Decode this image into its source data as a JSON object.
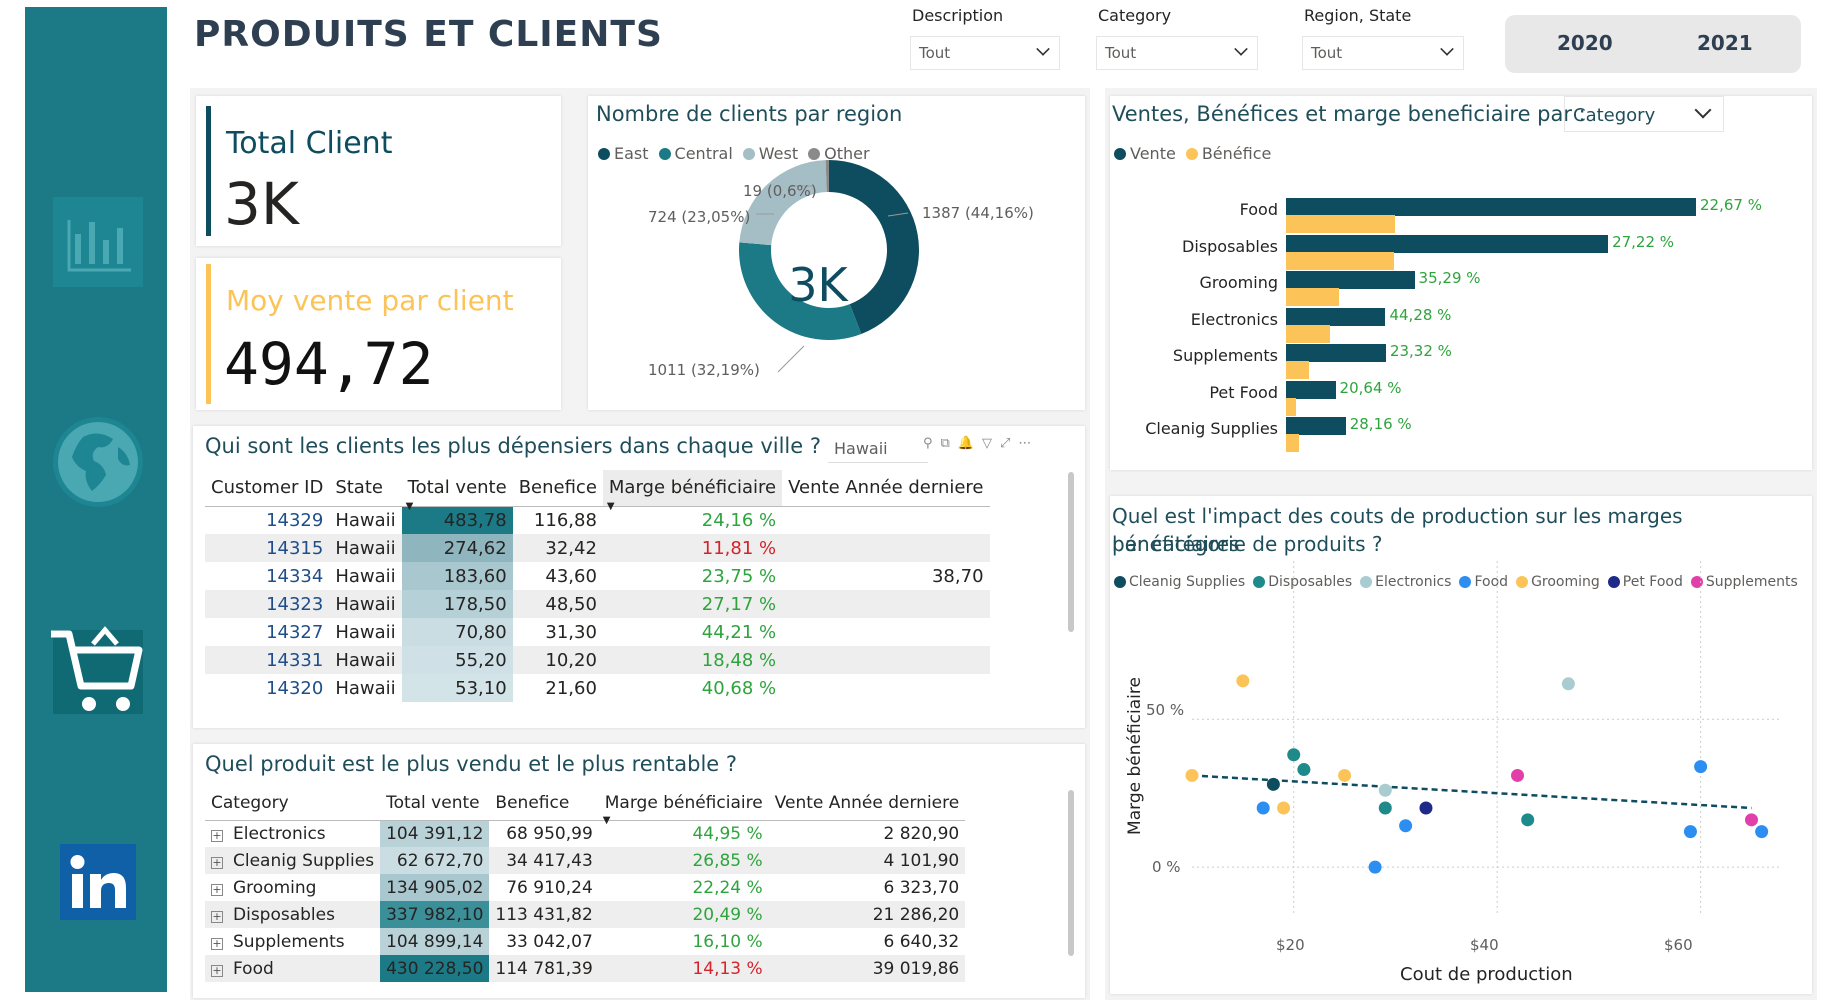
{
  "title": "PRODUITS ET CLIENTS",
  "slicers": [
    {
      "label": "Description",
      "value": "Tout"
    },
    {
      "label": "Category",
      "value": "Tout"
    },
    {
      "label": "Region, State",
      "value": "Tout"
    }
  ],
  "years": [
    "2020",
    "2021"
  ],
  "kpi_total": {
    "label": "Total Client",
    "value": "3K"
  },
  "kpi_avg": {
    "label": "Moy vente par client",
    "value": "494,72"
  },
  "colors": {
    "teal_dark": "#0d4d5f",
    "teal": "#1b7a85",
    "west": "#a5bec6",
    "other": "#8a8a8a",
    "yellow": "#fcc458",
    "green": "#2ea43d",
    "red": "#d6222a"
  },
  "donut": {
    "title": "Nombre de clients par region",
    "center": "3K",
    "legend": [
      "East",
      "Central",
      "West",
      "Other"
    ],
    "labels": [
      "1387 (44,16%)",
      "1011 (32,19%)",
      "724 (23,05%)",
      "19 (0,6%)"
    ]
  },
  "top_clients": {
    "title": "Qui sont les clients les plus dépensiers dans chaque ville ?",
    "filter_value": "Hawaii",
    "columns": [
      "Customer ID",
      "State",
      "Total vente",
      "Benefice",
      "Marge bénéficiaire",
      "Vente Année derniere"
    ],
    "rows": [
      {
        "id": "14329",
        "state": "Hawaii",
        "vente": "483,78",
        "benefice": "116,88",
        "marge": "24,16 %",
        "last": ""
      },
      {
        "id": "14315",
        "state": "Hawaii",
        "vente": "274,62",
        "benefice": "32,42",
        "marge": "11,81 %",
        "last": ""
      },
      {
        "id": "14334",
        "state": "Hawaii",
        "vente": "183,60",
        "benefice": "43,60",
        "marge": "23,75 %",
        "last": "38,70"
      },
      {
        "id": "14323",
        "state": "Hawaii",
        "vente": "178,50",
        "benefice": "48,50",
        "marge": "27,17 %",
        "last": ""
      },
      {
        "id": "14327",
        "state": "Hawaii",
        "vente": "70,80",
        "benefice": "31,30",
        "marge": "44,21 %",
        "last": ""
      },
      {
        "id": "14331",
        "state": "Hawaii",
        "vente": "55,20",
        "benefice": "10,20",
        "marge": "18,48 %",
        "last": ""
      },
      {
        "id": "14320",
        "state": "Hawaii",
        "vente": "53,10",
        "benefice": "21,60",
        "marge": "40,68 %",
        "last": ""
      }
    ]
  },
  "products": {
    "title": "Quel produit est le plus vendu et le plus rentable ?",
    "columns": [
      "Category",
      "Total vente",
      "Benefice",
      "Marge bénéficiaire",
      "Vente Année derniere"
    ],
    "rows": [
      {
        "cat": "Electronics",
        "vente": "104 391,12",
        "benefice": "68 950,99",
        "marge": "44,95 %",
        "last": "2 820,90"
      },
      {
        "cat": "Cleanig Supplies",
        "vente": "62 672,70",
        "benefice": "34 417,43",
        "marge": "26,85 %",
        "last": "4 101,90"
      },
      {
        "cat": "Grooming",
        "vente": "134 905,02",
        "benefice": "76 910,24",
        "marge": "22,24 %",
        "last": "6 323,70"
      },
      {
        "cat": "Disposables",
        "vente": "337 982,10",
        "benefice": "113 431,82",
        "marge": "20,49 %",
        "last": "21 286,20"
      },
      {
        "cat": "Supplements",
        "vente": "104 899,14",
        "benefice": "33 042,07",
        "marge": "16,10 %",
        "last": "6 640,32"
      },
      {
        "cat": "Food",
        "vente": "430 228,50",
        "benefice": "114 781,39",
        "marge": "14,13 %",
        "last": "39 019,86"
      }
    ]
  },
  "bar_chart": {
    "title": "Ventes, Bénéfices et marge beneficiaire par :",
    "dropdown": "Category",
    "legend": [
      "Vente",
      "Bénéfice"
    ]
  },
  "scatter": {
    "title_line1": "Quel est l'impact des couts de production sur les marges bénéficiaires",
    "title_line2": "par catégorie de produits ?",
    "ylabel": "Marge bénéficiaire",
    "xlabel": "Cout de production",
    "y_ticks": [
      "50 %",
      "0 %"
    ],
    "x_ticks": [
      "$20",
      "$40",
      "$60"
    ],
    "legend": [
      {
        "name": "Cleanig Supplies",
        "color": "#0d4d5f"
      },
      {
        "name": "Disposables",
        "color": "#1f8a8a"
      },
      {
        "name": "Electronics",
        "color": "#a9ccd0"
      },
      {
        "name": "Food",
        "color": "#2c8ef0"
      },
      {
        "name": "Grooming",
        "color": "#fcc458"
      },
      {
        "name": "Pet Food",
        "color": "#1e2a8a"
      },
      {
        "name": "Supplements",
        "color": "#e040a8"
      }
    ]
  },
  "chart_data": [
    {
      "type": "pie",
      "title": "Nombre de clients par region",
      "categories": [
        "East",
        "Central",
        "West",
        "Other"
      ],
      "values": [
        1387,
        1011,
        724,
        19
      ]
    },
    {
      "type": "bar",
      "orientation": "horizontal",
      "title": "Ventes, Bénéfices et marge beneficiaire par :",
      "categories": [
        "Food",
        "Disposables",
        "Grooming",
        "Electronics",
        "Supplements",
        "Pet Food",
        "Cleanig Supplies"
      ],
      "series": [
        {
          "name": "Vente",
          "values": [
            430228.5,
            337982.1,
            134905.02,
            104391.12,
            104899.14,
            52000,
            62672.7
          ]
        },
        {
          "name": "Bénéfice",
          "values": [
            114781.39,
            113431.82,
            56000,
            46000,
            24000,
            11000,
            14000
          ]
        }
      ],
      "labels": [
        "22,67 %",
        "27,22 %",
        "35,29 %",
        "44,28 %",
        "23,32 %",
        "20,64 %",
        "28,16 %"
      ]
    },
    {
      "type": "scatter",
      "xlabel": "Cout de production",
      "ylabel": "Marge bénéficiaire",
      "xlim": [
        10,
        68
      ],
      "ylim": [
        -0.03,
        0.9
      ],
      "trend": [
        [
          10,
          0.31
        ],
        [
          65,
          0.2
        ]
      ],
      "points": [
        {
          "series": "Grooming",
          "x": 15,
          "y": 0.63
        },
        {
          "series": "Grooming",
          "x": 10,
          "y": 0.31
        },
        {
          "series": "Grooming",
          "x": 19,
          "y": 0.2
        },
        {
          "series": "Grooming",
          "x": 25,
          "y": 0.31
        },
        {
          "series": "Electronics",
          "x": 47,
          "y": 0.62
        },
        {
          "series": "Electronics",
          "x": 29,
          "y": 0.26
        },
        {
          "series": "Disposables",
          "x": 20,
          "y": 0.38
        },
        {
          "series": "Disposables",
          "x": 21,
          "y": 0.33
        },
        {
          "series": "Disposables",
          "x": 29,
          "y": 0.2
        },
        {
          "series": "Disposables",
          "x": 43,
          "y": 0.16
        },
        {
          "series": "Cleanig Supplies",
          "x": 18,
          "y": 0.28
        },
        {
          "series": "Food",
          "x": 17,
          "y": 0.2
        },
        {
          "series": "Food",
          "x": 31,
          "y": 0.14
        },
        {
          "series": "Food",
          "x": 28,
          "y": 0.0
        },
        {
          "series": "Food",
          "x": 60,
          "y": 0.34
        },
        {
          "series": "Food",
          "x": 59,
          "y": 0.12
        },
        {
          "series": "Food",
          "x": 66,
          "y": 0.12
        },
        {
          "series": "Pet Food",
          "x": 33,
          "y": 0.2
        },
        {
          "series": "Supplements",
          "x": 42,
          "y": 0.31
        },
        {
          "series": "Supplements",
          "x": 65,
          "y": 0.16
        }
      ]
    }
  ]
}
